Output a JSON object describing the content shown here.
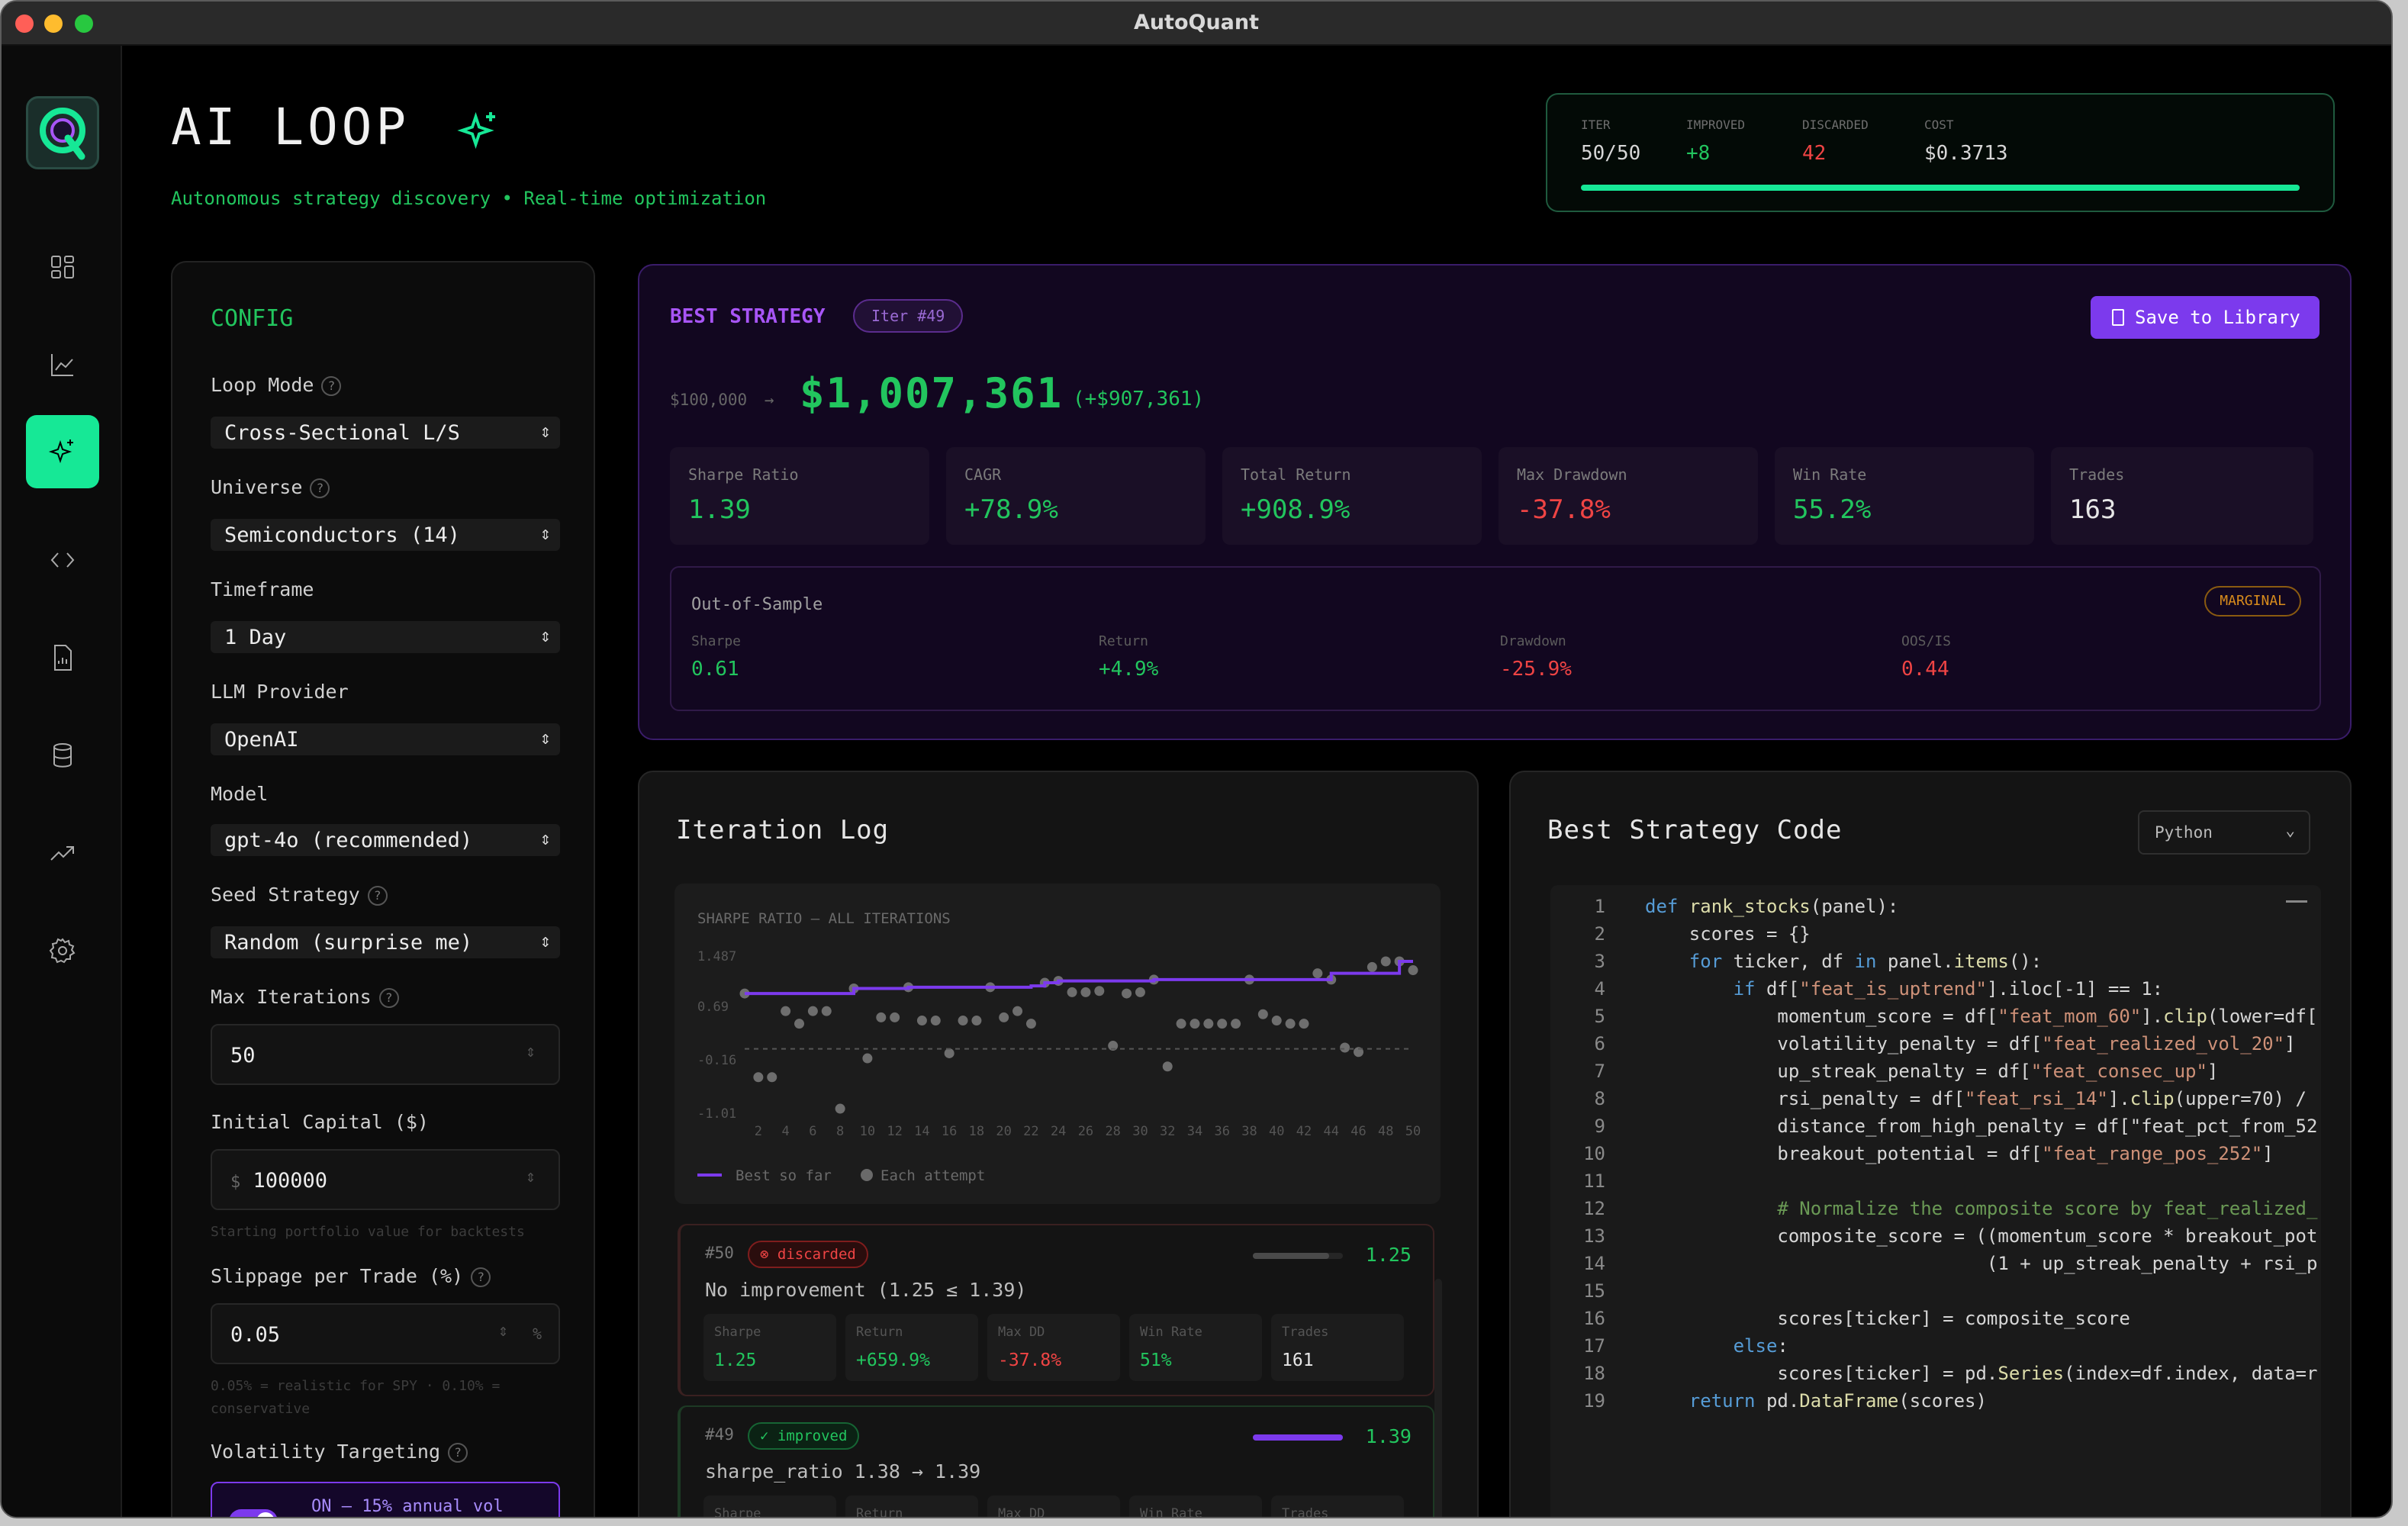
{
  "window": {
    "title": "AutoQuant"
  },
  "header": {
    "title": "AI LOOP",
    "subtitle": "Autonomous strategy discovery • Real-time optimization"
  },
  "stats": [
    {
      "label": "ITER",
      "value": "50/50",
      "color": "#d6d6d6"
    },
    {
      "label": "IMPROVED",
      "value": "+8",
      "color": "#22c55e"
    },
    {
      "label": "DISCARDED",
      "value": "42",
      "color": "#ef4444"
    },
    {
      "label": "COST",
      "value": "$0.3713",
      "color": "#d6d6d6"
    }
  ],
  "progress": 1.0,
  "config": {
    "title": "CONFIG",
    "loop_mode": {
      "label": "Loop Mode",
      "value": "Cross-Sectional L/S"
    },
    "universe": {
      "label": "Universe",
      "value": "Semiconductors (14)"
    },
    "timeframe": {
      "label": "Timeframe",
      "value": "1 Day"
    },
    "llm_provider": {
      "label": "LLM Provider",
      "value": "OpenAI"
    },
    "model": {
      "label": "Model",
      "value": "gpt-4o (recommended)"
    },
    "seed_strategy": {
      "label": "Seed Strategy",
      "value": "Random (surprise me)"
    },
    "max_iterations": {
      "label": "Max Iterations",
      "value": "50"
    },
    "initial_capital": {
      "label": "Initial Capital ($)",
      "prefix": "$",
      "value": "100000",
      "hint": "Starting portfolio value for backtests"
    },
    "slippage": {
      "label": "Slippage per Trade (%)",
      "value": "0.05",
      "suffix": "%",
      "hint1": "0.05% = realistic for SPY · 0.10% =",
      "hint2": "conservative"
    },
    "vol_targeting": {
      "label": "Volatility Targeting",
      "toggle_text": "ON — 15% annual vol"
    }
  },
  "best": {
    "title": "BEST STRATEGY",
    "iter": "Iter #49",
    "save_label": "Save to Library",
    "start_capital": "$100,000",
    "arrow": "→",
    "final_capital": "$1,007,361",
    "delta": "(+$907,361)",
    "metrics": [
      {
        "label": "Sharpe Ratio",
        "value": "1.39",
        "color": "#22c55e"
      },
      {
        "label": "CAGR",
        "value": "+78.9%",
        "color": "#22c55e"
      },
      {
        "label": "Total Return",
        "value": "+908.9%",
        "color": "#22c55e"
      },
      {
        "label": "Max Drawdown",
        "value": "-37.8%",
        "color": "#ef4444"
      },
      {
        "label": "Win Rate",
        "value": "55.2%",
        "color": "#22c55e"
      },
      {
        "label": "Trades",
        "value": "163",
        "color": "#e6e6e6"
      }
    ],
    "oos": {
      "title": "Out-of-Sample",
      "badge": "MARGINAL",
      "items": [
        {
          "label": "Sharpe",
          "value": "0.61",
          "color": "#22c55e"
        },
        {
          "label": "Return",
          "value": "+4.9%",
          "color": "#22c55e"
        },
        {
          "label": "Drawdown",
          "value": "-25.9%",
          "color": "#ef4444"
        },
        {
          "label": "OOS/IS",
          "value": "0.44",
          "color": "#ef4444"
        }
      ]
    }
  },
  "log": {
    "title": "Iteration Log",
    "entries": [
      {
        "id": "#50",
        "status": "discarded",
        "desc": "No improvement (1.25 ≤ 1.39)",
        "score": "1.25",
        "bar": 0.85,
        "barcolor": "#4a4a4a",
        "cards": [
          {
            "label": "Sharpe",
            "value": "1.25",
            "color": "#22c55e"
          },
          {
            "label": "Return",
            "value": "+659.9%",
            "color": "#22c55e"
          },
          {
            "label": "Max DD",
            "value": "-37.8%",
            "color": "#ef4444"
          },
          {
            "label": "Win Rate",
            "value": "51%",
            "color": "#22c55e"
          },
          {
            "label": "Trades",
            "value": "161",
            "color": "#e6e6e6"
          }
        ]
      },
      {
        "id": "#49",
        "status": "improved",
        "desc": "sharpe_ratio 1.38 → 1.39",
        "score": "1.39",
        "bar": 1.0,
        "barcolor": "#7c3aed",
        "cards": [
          {
            "label": "Sharpe"
          },
          {
            "label": "Return"
          },
          {
            "label": "Max DD"
          },
          {
            "label": "Win Rate"
          },
          {
            "label": "Trades"
          }
        ]
      }
    ]
  },
  "chart_data": {
    "type": "scatter",
    "title": "SHARPE RATIO — ALL ITERATIONS",
    "y_ticks": [
      "1.487",
      "0.69",
      "-0.16",
      "-1.01"
    ],
    "ylim": [
      -1.01,
      1.487
    ],
    "x_ticks": [
      "2",
      "4",
      "6",
      "8",
      "10",
      "12",
      "14",
      "16",
      "18",
      "20",
      "22",
      "24",
      "26",
      "28",
      "30",
      "32",
      "34",
      "36",
      "38",
      "40",
      "42",
      "44",
      "46",
      "48",
      "50"
    ],
    "xlim": [
      1,
      50
    ],
    "baseline": 0,
    "legend": [
      "Best so far",
      "Each attempt"
    ],
    "series": [
      {
        "name": "Best so far",
        "x": [
          1,
          5,
          9,
          13,
          18,
          22,
          23,
          24,
          31,
          39,
          44,
          49
        ],
        "y": [
          0.88,
          0.88,
          0.96,
          0.98,
          0.98,
          1.0,
          1.05,
          1.08,
          1.1,
          1.1,
          1.2,
          1.39
        ]
      },
      {
        "name": "Each attempt",
        "x": [
          1,
          2,
          3,
          4,
          5,
          6,
          7,
          8,
          9,
          10,
          11,
          12,
          13,
          14,
          15,
          16,
          17,
          18,
          19,
          20,
          21,
          22,
          23,
          24,
          25,
          26,
          27,
          28,
          29,
          30,
          31,
          32,
          33,
          34,
          35,
          36,
          37,
          38,
          39,
          40,
          41,
          42,
          43,
          44,
          45,
          46,
          47,
          48,
          49,
          50
        ],
        "y": [
          0.88,
          -0.45,
          -0.45,
          0.6,
          0.4,
          0.6,
          0.6,
          -0.95,
          0.96,
          -0.15,
          0.5,
          0.5,
          0.98,
          0.45,
          0.45,
          -0.07,
          0.45,
          0.45,
          0.98,
          0.5,
          0.6,
          0.4,
          1.05,
          1.08,
          0.9,
          0.9,
          0.92,
          0.05,
          0.88,
          0.9,
          1.1,
          -0.28,
          0.4,
          0.4,
          0.4,
          0.4,
          0.4,
          1.1,
          0.55,
          0.45,
          0.4,
          0.4,
          1.2,
          1.1,
          0.02,
          -0.05,
          1.3,
          1.39,
          1.39,
          1.25
        ]
      }
    ]
  },
  "code": {
    "title": "Best Strategy Code",
    "language": "Python",
    "lines": [
      "def rank_stocks(panel):",
      "    scores = {}",
      "    for ticker, df in panel.items():",
      "        if df[\"feat_is_uptrend\"].iloc[-1] == 1:",
      "            momentum_score = df[\"feat_mom_60\"].clip(lower=df[",
      "            volatility_penalty = df[\"feat_realized_vol_20\"]",
      "            up_streak_penalty = df[\"feat_consec_up\"]",
      "            rsi_penalty = df[\"feat_rsi_14\"].clip(upper=70) /",
      "            distance_from_high_penalty = df[\"feat_pct_from_52",
      "            breakout_potential = df[\"feat_range_pos_252\"]",
      "",
      "            # Normalize the composite score by feat_realized_",
      "            composite_score = ((momentum_score * breakout_pot",
      "                               (1 + up_streak_penalty + rsi_p",
      "",
      "            scores[ticker] = composite_score",
      "        else:",
      "            scores[ticker] = pd.Series(index=df.index, data=r",
      "    return pd.DataFrame(scores)"
    ]
  }
}
